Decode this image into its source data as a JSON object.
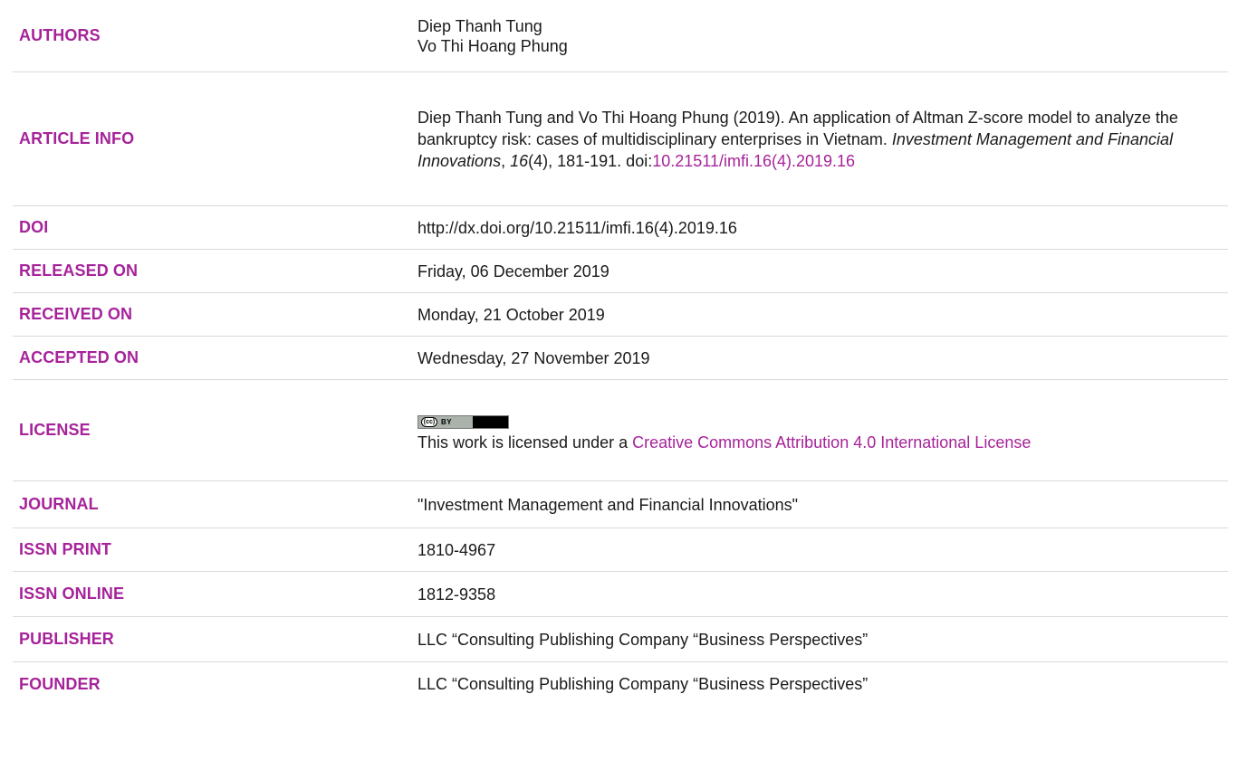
{
  "rows": {
    "authors": {
      "label": "AUTHORS",
      "lines": [
        "Diep Thanh Tung",
        "Vo Thi Hoang Phung"
      ]
    },
    "article_info": {
      "label": "ARTICLE INFO",
      "part1": "Diep Thanh Tung and Vo Thi Hoang Phung (2019). An application of Altman Z-score model to analyze the bankruptcy risk: cases of multidisciplinary enterprises in Vietnam. ",
      "journal_italic": "Investment Management and Financial Innovations",
      "comma": ", ",
      "volume_italic": "16",
      "part2": "(4), 181-191. doi:",
      "doi_link": "10.21511/imfi.16(4).2019.16"
    },
    "doi": {
      "label": "DOI",
      "value": "http://dx.doi.org/10.21511/imfi.16(4).2019.16"
    },
    "released_on": {
      "label": "RELEASED ON",
      "value": "Friday, 06 December 2019"
    },
    "received_on": {
      "label": "RECEIVED ON",
      "value": "Monday, 21 October 2019"
    },
    "accepted_on": {
      "label": "ACCEPTED ON",
      "value": "Wednesday, 27 November 2019"
    },
    "license": {
      "label": "LICENSE",
      "badge_cc": "(cc)",
      "badge_by": "BY",
      "text_prefix": "This work is licensed under a ",
      "link_text": "Creative Commons Attribution 4.0 International License"
    },
    "journal": {
      "label": "JOURNAL",
      "value": "\"Investment Management and Financial Innovations\""
    },
    "issn_print": {
      "label": "ISSN PRINT",
      "value": "1810-4967"
    },
    "issn_online": {
      "label": "ISSN ONLINE",
      "value": "1812-9358"
    },
    "publisher": {
      "label": "PUBLISHER",
      "value": "LLC “Consulting Publishing Company “Business Perspectives”"
    },
    "founder": {
      "label": "FOUNDER",
      "value": "LLC “Consulting Publishing Company “Business Perspectives”"
    }
  },
  "colors": {
    "label": "#a6239a",
    "link": "#a6239a",
    "text": "#1a1a1a",
    "divider": "#d9d9d9"
  }
}
